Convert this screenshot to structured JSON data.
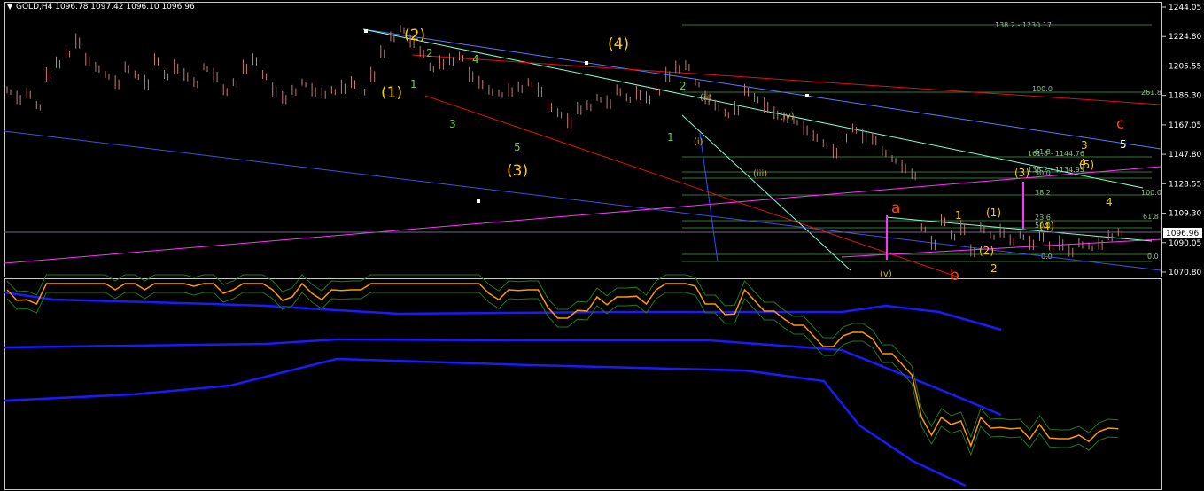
{
  "header": {
    "symbol_line": "GOLD,H4  1096.78 1097.42 1096.10 1096.96"
  },
  "price_axis": {
    "ticks": [
      "1244.05",
      "1224.80",
      "1205.55",
      "1186.30",
      "1167.05",
      "1147.80",
      "1128.55",
      "1109.30",
      "1090.05",
      "1070.80"
    ],
    "current_price": "1096.96"
  },
  "fib_labels": [
    "138.2 - 1230.17",
    "100.0",
    "261.8",
    "161.8 - 1144.76",
    "138.2 - 1134.95",
    "61.8",
    "50.0",
    "100.0",
    "38.2",
    "23.6",
    "61.8",
    "50.0",
    "0.0",
    "0.0"
  ],
  "wave_labels": {
    "big_yellow": [
      "(2)",
      "(4)",
      "(1)",
      "(3)"
    ],
    "small_green": [
      "2",
      "4",
      "1",
      "3",
      "5",
      "2",
      "1"
    ],
    "orange": [
      "a",
      "c",
      "b"
    ],
    "roman": [
      "(ii)",
      "(i)",
      "(iv)",
      "(iii)",
      "(v)"
    ],
    "right_yellow": [
      "1",
      "(1)",
      "(3)",
      "(5)",
      "(4)",
      "(2)",
      "2",
      "3",
      "4",
      "4"
    ],
    "right_white": [
      "5"
    ]
  },
  "colors": {
    "background": "#000000",
    "candles": "#c87a7a",
    "oscillator": "#ff9900",
    "bands": "#1a1aff",
    "channel_red": "#e01010",
    "trend_blue": "#5a78ff",
    "trend_green": "#7fffd4",
    "magenta": "#ff33ff",
    "fib": "#2e7d32",
    "wave_yellow": "#ffcc00",
    "wave_green": "#66cc44",
    "wave_orange": "#ff4400"
  },
  "chart_data": {
    "type": "line",
    "title": "GOLD,H4",
    "ylim": [
      1066,
      1250
    ],
    "y_ticks": [
      1244.05,
      1224.8,
      1205.55,
      1186.3,
      1167.05,
      1147.8,
      1128.55,
      1109.3,
      1090.05,
      1070.8
    ],
    "last_price": 1096.96,
    "series": [
      {
        "name": "GOLD,H4",
        "x": [
          0,
          10,
          20,
          30,
          40,
          50,
          60,
          70,
          80,
          90,
          100,
          110,
          120,
          130,
          140,
          150,
          160,
          170,
          180,
          190,
          200,
          210,
          220,
          230,
          240,
          250,
          260,
          270,
          280,
          290,
          300,
          310,
          320,
          330,
          340,
          350,
          360,
          370,
          380,
          390,
          400,
          410,
          420,
          430,
          440,
          450,
          460,
          470,
          480,
          490,
          500,
          510,
          520,
          530,
          540,
          550,
          560,
          570,
          580,
          590,
          600,
          610,
          620,
          630,
          640,
          650,
          660,
          670,
          680,
          690,
          700,
          710,
          720,
          730,
          740,
          750,
          760,
          770,
          780,
          790,
          800,
          810,
          820,
          830,
          840,
          850,
          860,
          870,
          880,
          890,
          900,
          910,
          920,
          930,
          940,
          950,
          960,
          970,
          980,
          990,
          1000,
          1010,
          1020,
          1030,
          1040,
          1050,
          1060,
          1070,
          1080,
          1090,
          1100,
          1110,
          1120,
          1130
        ],
        "values": [
          1190,
          1185,
          1188,
          1180,
          1200,
          1208,
          1215,
          1222,
          1210,
          1205,
          1200,
          1195,
          1205,
          1200,
          1195,
          1210,
          1200,
          1205,
          1200,
          1195,
          1205,
          1200,
          1190,
          1195,
          1205,
          1210,
          1200,
          1190,
          1185,
          1190,
          1195,
          1190,
          1188,
          1190,
          1192,
          1195,
          1190,
          1200,
          1215,
          1225,
          1230,
          1222,
          1215,
          1205,
          1208,
          1210,
          1212,
          1200,
          1195,
          1190,
          1188,
          1190,
          1192,
          1195,
          1190,
          1180,
          1175,
          1170,
          1178,
          1180,
          1185,
          1182,
          1190,
          1185,
          1188,
          1185,
          1190,
          1200,
          1205,
          1206,
          1195,
          1185,
          1180,
          1175,
          1178,
          1190,
          1185,
          1180,
          1175,
          1172,
          1170,
          1165,
          1160,
          1155,
          1150,
          1160,
          1165,
          1160,
          1158,
          1150,
          1145,
          1140,
          1135,
          1100,
          1090,
          1105,
          1095,
          1100,
          1085,
          1100,
          1095,
          1098,
          1092,
          1095,
          1090,
          1095,
          1088,
          1090,
          1085,
          1090,
          1088,
          1090,
          1095,
          1097
        ]
      }
    ]
  }
}
